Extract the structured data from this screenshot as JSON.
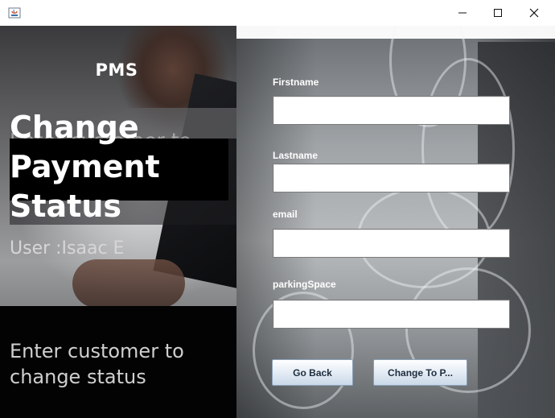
{
  "window": {
    "app_icon": "java-icon",
    "controls": {
      "minimize": "minimize-icon",
      "maximize": "maximize-icon",
      "close": "close-icon"
    }
  },
  "left_panel": {
    "app_name": "PMS",
    "heading": "Change Payment Status",
    "background_overlay_text": "Enter customer to",
    "user_label": "User :Isaac E",
    "instruction": "Enter customer to change status"
  },
  "form": {
    "firstname": {
      "label": "Firstname",
      "value": ""
    },
    "lastname": {
      "label": "Lastname",
      "value": ""
    },
    "email": {
      "label": "email",
      "value": ""
    },
    "parking_space": {
      "label": "parkingSpace",
      "value": ""
    }
  },
  "buttons": {
    "go_back": "Go Back",
    "change": "Change To P..."
  },
  "colors": {
    "heading_text": "#ffffff",
    "button_gradient_top": "#ffffff",
    "button_gradient_bottom": "#c9d8e8",
    "button_text": "#1e2d3d"
  }
}
